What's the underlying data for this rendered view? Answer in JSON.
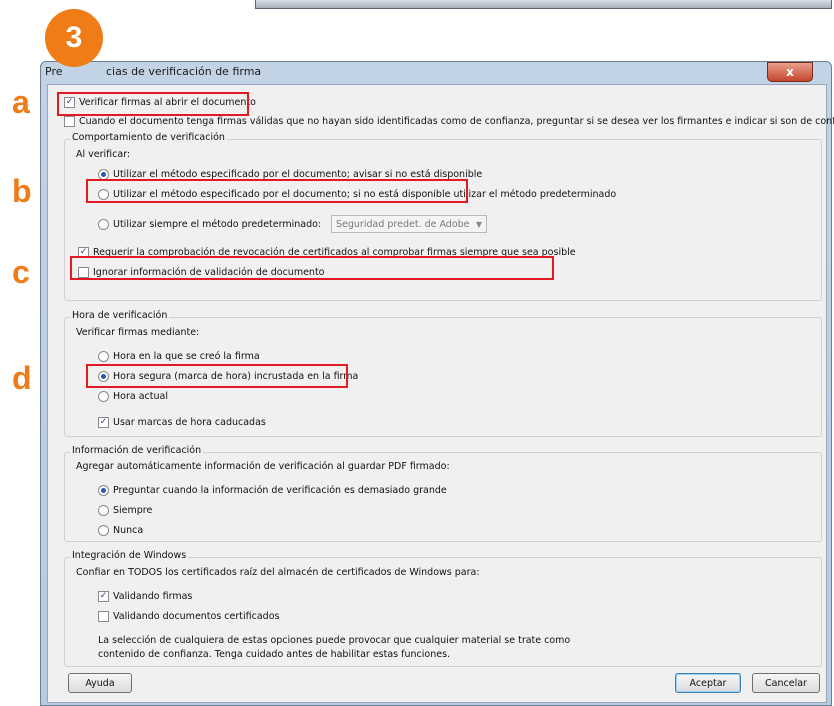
{
  "annotation": {
    "step": "3",
    "letters": [
      "a",
      "b",
      "c",
      "d"
    ]
  },
  "dialog": {
    "title_prefix": "Pre",
    "title": "cias de verificación de firma",
    "close_label": "x"
  },
  "top": {
    "verify_on_open": {
      "label": "Verificar firmas al abrir el documento",
      "checked": true
    },
    "ask_untrusted": {
      "label": "Cuando el documento tenga firmas válidas que no hayan sido identificadas como de confianza, preguntar si se desea ver los firmantes e indicar si son de confianza",
      "checked": false
    }
  },
  "behavior": {
    "title": "Comportamiento de verificación",
    "when_label": "Al verificar:",
    "options": [
      {
        "label": "Utilizar el método especificado por el documento; avisar si no está disponible",
        "selected": true
      },
      {
        "label": "Utilizar el método especificado por el documento; si no está disponible utilizar el método predeterminado",
        "selected": false
      },
      {
        "label": "Utilizar siempre el método predeterminado:",
        "selected": false
      }
    ],
    "default_method": "Seguridad predet. de Adobe",
    "revocation": {
      "label": "Requerir la comprobación de revocación de certificados al comprobar firmas siempre que sea posible",
      "checked": true
    },
    "ignore_validation": {
      "label": "Ignorar información de validación de documento",
      "checked": false
    }
  },
  "time": {
    "title": "Hora de verificación",
    "verify_label": "Verificar firmas mediante:",
    "options": [
      {
        "label": "Hora en la que se creó la firma",
        "selected": false
      },
      {
        "label": "Hora segura (marca de hora) incrustada en la firma",
        "selected": true
      },
      {
        "label": "Hora actual",
        "selected": false
      }
    ],
    "expired": {
      "label": "Usar marcas de hora caducadas",
      "checked": true
    }
  },
  "info": {
    "title": "Información de verificación",
    "add_label": "Agregar automáticamente información de verificación al guardar PDF firmado:",
    "options": [
      {
        "label": "Preguntar cuando la información de verificación es demasiado grande",
        "selected": true
      },
      {
        "label": "Siempre",
        "selected": false
      },
      {
        "label": "Nunca",
        "selected": false
      }
    ]
  },
  "windows": {
    "title": "Integración de Windows",
    "trust_label": "Confiar en TODOS los certificados raíz del almacén de certificados de Windows para:",
    "validating_signatures": {
      "label": "Validando firmas",
      "checked": true
    },
    "validating_docs": {
      "label": "Validando documentos certificados",
      "checked": false
    },
    "warning_line1": "La selección de cualquiera de estas opciones puede provocar que cualquier material se trate como",
    "warning_line2": "contenido de confianza. Tenga cuidado antes de habilitar estas funciones."
  },
  "buttons": {
    "help": "Ayuda",
    "ok": "Aceptar",
    "cancel": "Cancelar"
  },
  "glyphs": {
    "check": "✓"
  },
  "colors": {
    "annotation": "#f07c18",
    "highlight": "#e01b24"
  }
}
